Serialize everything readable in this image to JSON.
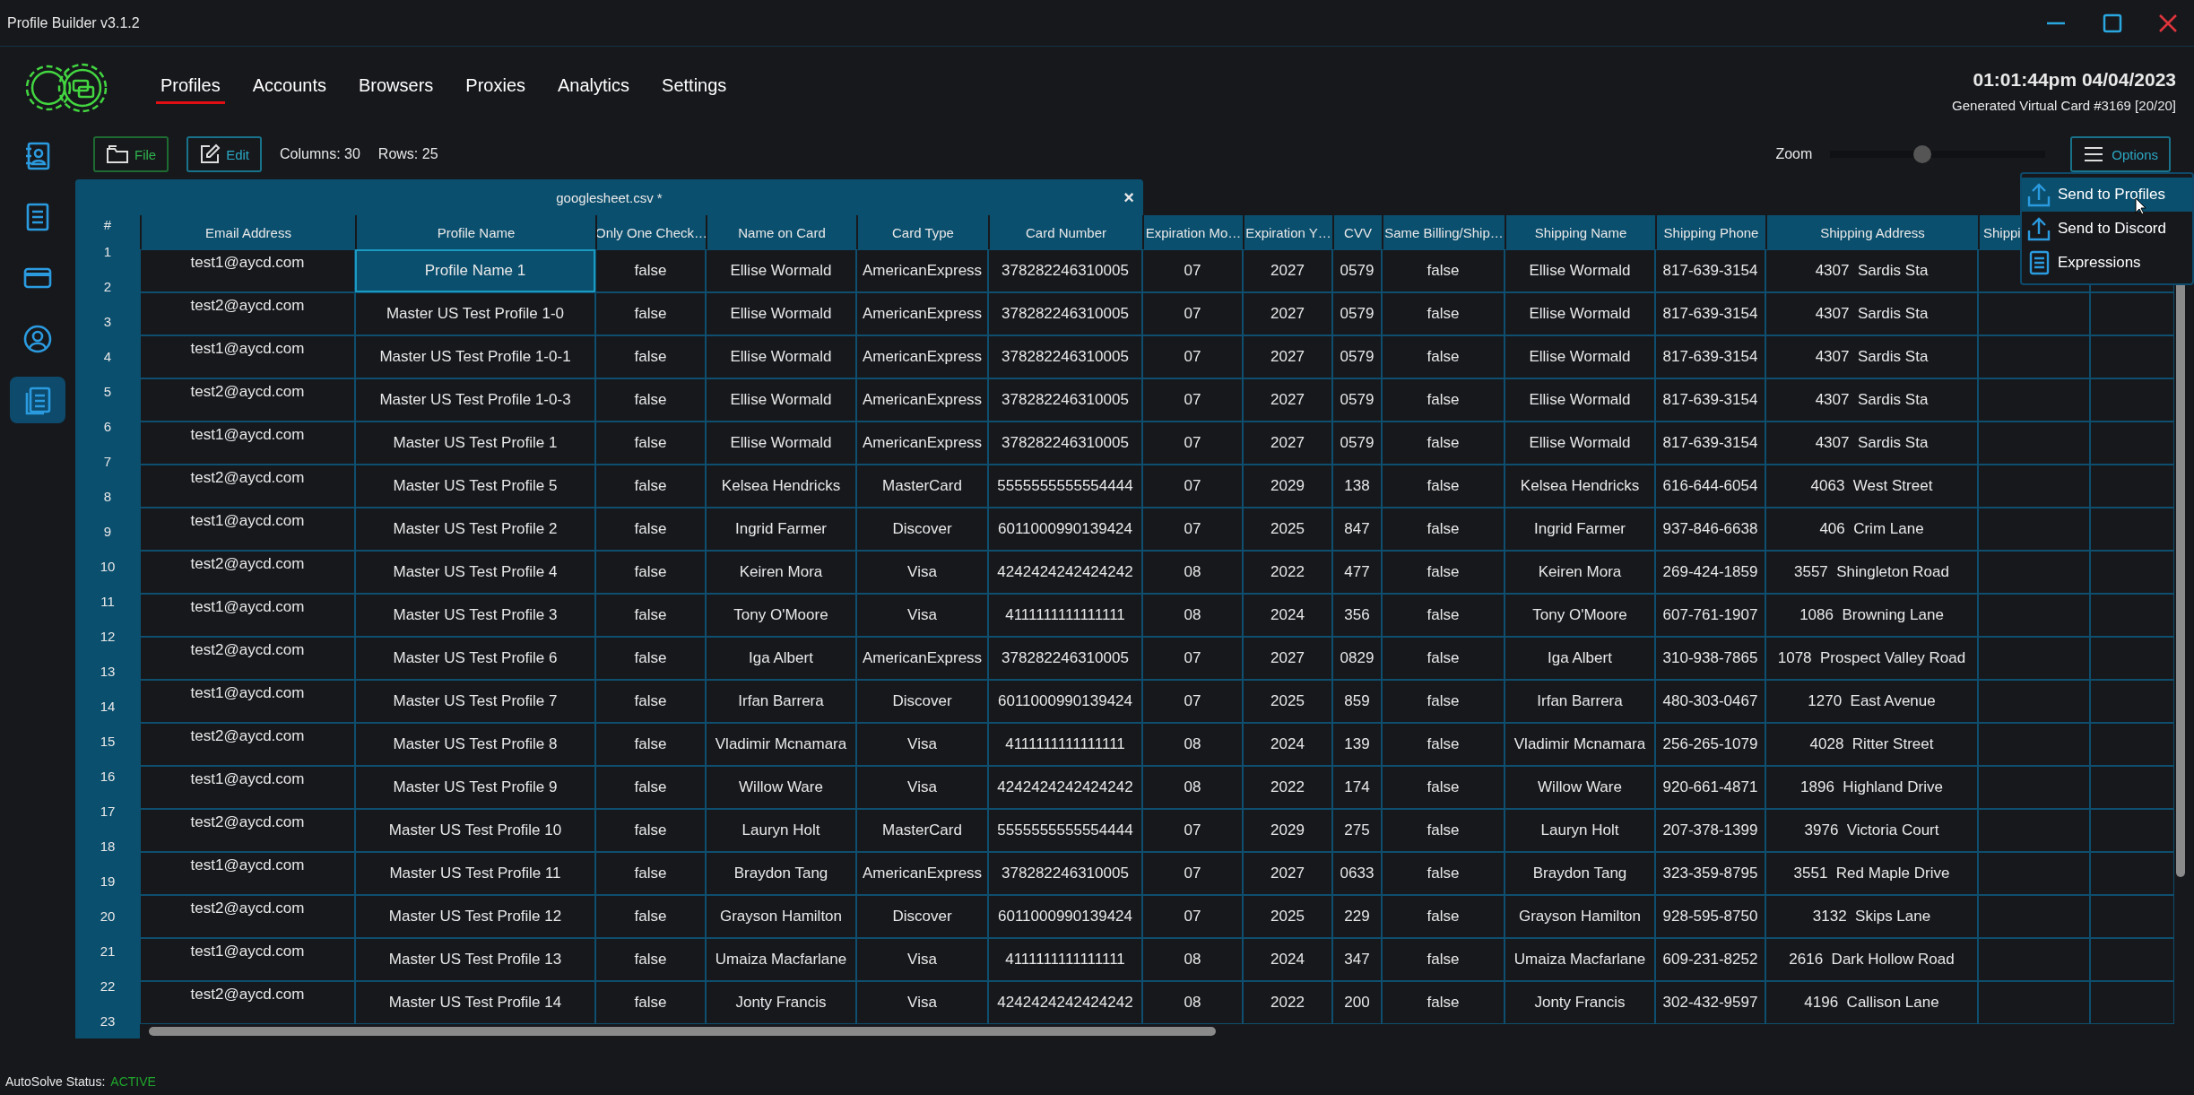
{
  "window": {
    "title": "Profile Builder v3.1.2"
  },
  "nav": [
    {
      "label": "Profiles",
      "selected": true
    },
    {
      "label": "Accounts",
      "selected": false
    },
    {
      "label": "Browsers",
      "selected": false
    },
    {
      "label": "Proxies",
      "selected": false
    },
    {
      "label": "Analytics",
      "selected": false
    },
    {
      "label": "Settings",
      "selected": false
    }
  ],
  "clock": "01:01:44pm 04/04/2023",
  "card_status": "Generated Virtual Card #3169 [20/20]",
  "sidebar": {
    "items": [
      {
        "kind": "contacts",
        "selected": false
      },
      {
        "kind": "document",
        "selected": false
      },
      {
        "kind": "card",
        "selected": false
      },
      {
        "kind": "user",
        "selected": false
      },
      {
        "kind": "pages",
        "selected": true
      }
    ]
  },
  "toolbar": {
    "file": "File",
    "edit": "Edit",
    "columns": "Columns: 30",
    "rows": "Rows: 25",
    "zoom_label": "Zoom",
    "zoom": {
      "level": 0.43
    },
    "options": "Options"
  },
  "menu": [
    {
      "label": "Send to Profiles",
      "kind": "upload",
      "selected": true
    },
    {
      "label": "Send to Discord",
      "kind": "upload",
      "selected": false
    },
    {
      "label": "Expressions",
      "kind": "book",
      "selected": false
    }
  ],
  "table": {
    "tab": "googlesheet.csv *",
    "close": "×",
    "index_header": "#",
    "row_numbers": [
      "1",
      "2",
      "3",
      "4",
      "5",
      "6",
      "7",
      "8",
      "9",
      "10",
      "11",
      "12",
      "13",
      "14",
      "15",
      "16",
      "17",
      "18",
      "19",
      "20",
      "21",
      "22",
      "23"
    ],
    "columns": [
      "Email Address",
      "Profile Name",
      "Only One Check…",
      "Name on Card",
      "Card Type",
      "Card Number",
      "Expiration Mo…",
      "Expiration Y…",
      "CVV",
      "Same Billing/Ship…",
      "Shipping Name",
      "Shipping Phone",
      "Shipping Address",
      "Shippi"
    ],
    "rows": [
      {
        "selected": true,
        "cells": [
          "test1@aycd.com",
          "Profile Name 1",
          "false",
          "Ellise Wormald",
          "AmericanExpress",
          "378282246310005",
          "07",
          "2027",
          "0579",
          "false",
          "Ellise Wormald",
          "817-639-3154",
          "4307  Sardis Sta"
        ]
      },
      {
        "selected": false,
        "cells": [
          "test2@aycd.com",
          "Master US Test Profile 1-0",
          "false",
          "Ellise Wormald",
          "AmericanExpress",
          "378282246310005",
          "07",
          "2027",
          "0579",
          "false",
          "Ellise Wormald",
          "817-639-3154",
          "4307  Sardis Sta"
        ]
      },
      {
        "selected": false,
        "cells": [
          "test1@aycd.com",
          "Master US Test Profile 1-0-1",
          "false",
          "Ellise Wormald",
          "AmericanExpress",
          "378282246310005",
          "07",
          "2027",
          "0579",
          "false",
          "Ellise Wormald",
          "817-639-3154",
          "4307  Sardis Sta"
        ]
      },
      {
        "selected": false,
        "cells": [
          "test2@aycd.com",
          "Master US Test Profile 1-0-3",
          "false",
          "Ellise Wormald",
          "AmericanExpress",
          "378282246310005",
          "07",
          "2027",
          "0579",
          "false",
          "Ellise Wormald",
          "817-639-3154",
          "4307  Sardis Sta"
        ]
      },
      {
        "selected": false,
        "cells": [
          "test1@aycd.com",
          "Master US Test Profile 1",
          "false",
          "Ellise Wormald",
          "AmericanExpress",
          "378282246310005",
          "07",
          "2027",
          "0579",
          "false",
          "Ellise Wormald",
          "817-639-3154",
          "4307  Sardis Sta"
        ]
      },
      {
        "selected": false,
        "cells": [
          "test2@aycd.com",
          "Master US Test Profile 5",
          "false",
          "Kelsea Hendricks",
          "MasterCard",
          "5555555555554444",
          "07",
          "2029",
          "138",
          "false",
          "Kelsea Hendricks",
          "616-644-6054",
          "4063  West Street"
        ]
      },
      {
        "selected": false,
        "cells": [
          "test1@aycd.com",
          "Master US Test Profile 2",
          "false",
          "Ingrid Farmer",
          "Discover",
          "6011000990139424",
          "07",
          "2025",
          "847",
          "false",
          "Ingrid Farmer",
          "937-846-6638",
          "406  Crim Lane"
        ]
      },
      {
        "selected": false,
        "cells": [
          "test2@aycd.com",
          "Master US Test Profile 4",
          "false",
          "Keiren Mora",
          "Visa",
          "4242424242424242",
          "08",
          "2022",
          "477",
          "false",
          "Keiren Mora",
          "269-424-1859",
          "3557  Shingleton Road"
        ]
      },
      {
        "selected": false,
        "cells": [
          "test1@aycd.com",
          "Master US Test Profile 3",
          "false",
          "Tony O'Moore",
          "Visa",
          "4111111111111111",
          "08",
          "2024",
          "356",
          "false",
          "Tony O'Moore",
          "607-761-1907",
          "1086  Browning Lane"
        ]
      },
      {
        "selected": false,
        "cells": [
          "test2@aycd.com",
          "Master US Test Profile 6",
          "false",
          "Iga Albert",
          "AmericanExpress",
          "378282246310005",
          "07",
          "2027",
          "0829",
          "false",
          "Iga Albert",
          "310-938-7865",
          "1078  Prospect Valley Road"
        ]
      },
      {
        "selected": false,
        "cells": [
          "test1@aycd.com",
          "Master US Test Profile 7",
          "false",
          "Irfan Barrera",
          "Discover",
          "6011000990139424",
          "07",
          "2025",
          "859",
          "false",
          "Irfan Barrera",
          "480-303-0467",
          "1270  East Avenue"
        ]
      },
      {
        "selected": false,
        "cells": [
          "test2@aycd.com",
          "Master US Test Profile 8",
          "false",
          "Vladimir Mcnamara",
          "Visa",
          "4111111111111111",
          "08",
          "2024",
          "139",
          "false",
          "Vladimir Mcnamara",
          "256-265-1079",
          "4028  Ritter Street"
        ]
      },
      {
        "selected": false,
        "cells": [
          "test1@aycd.com",
          "Master US Test Profile 9",
          "false",
          "Willow Ware",
          "Visa",
          "4242424242424242",
          "08",
          "2022",
          "174",
          "false",
          "Willow Ware",
          "920-661-4871",
          "1896  Highland Drive"
        ]
      },
      {
        "selected": false,
        "cells": [
          "test2@aycd.com",
          "Master US Test Profile 10",
          "false",
          "Lauryn Holt",
          "MasterCard",
          "5555555555554444",
          "07",
          "2029",
          "275",
          "false",
          "Lauryn Holt",
          "207-378-1399",
          "3976  Victoria Court"
        ]
      },
      {
        "selected": false,
        "cells": [
          "test1@aycd.com",
          "Master US Test Profile 11",
          "false",
          "Braydon Tang",
          "AmericanExpress",
          "378282246310005",
          "07",
          "2027",
          "0633",
          "false",
          "Braydon Tang",
          "323-359-8795",
          "3551  Red Maple Drive"
        ]
      },
      {
        "selected": false,
        "cells": [
          "test2@aycd.com",
          "Master US Test Profile 12",
          "false",
          "Grayson Hamilton",
          "Discover",
          "6011000990139424",
          "07",
          "2025",
          "229",
          "false",
          "Grayson Hamilton",
          "928-595-8750",
          "3132  Skips Lane"
        ]
      },
      {
        "selected": false,
        "cells": [
          "test1@aycd.com",
          "Master US Test Profile 13",
          "false",
          "Umaiza Macfarlane",
          "Visa",
          "4111111111111111",
          "08",
          "2024",
          "347",
          "false",
          "Umaiza Macfarlane",
          "609-231-8252",
          "2616  Dark Hollow Road"
        ]
      },
      {
        "selected": false,
        "cells": [
          "test2@aycd.com",
          "Master US Test Profile 14",
          "false",
          "Jonty Francis",
          "Visa",
          "4242424242424242",
          "08",
          "2022",
          "200",
          "false",
          "Jonty Francis",
          "302-432-9597",
          "4196  Callison Lane"
        ]
      }
    ]
  },
  "status": {
    "label": "AutoSolve Status:",
    "value": "ACTIVE",
    "color": "#1fa52c"
  }
}
